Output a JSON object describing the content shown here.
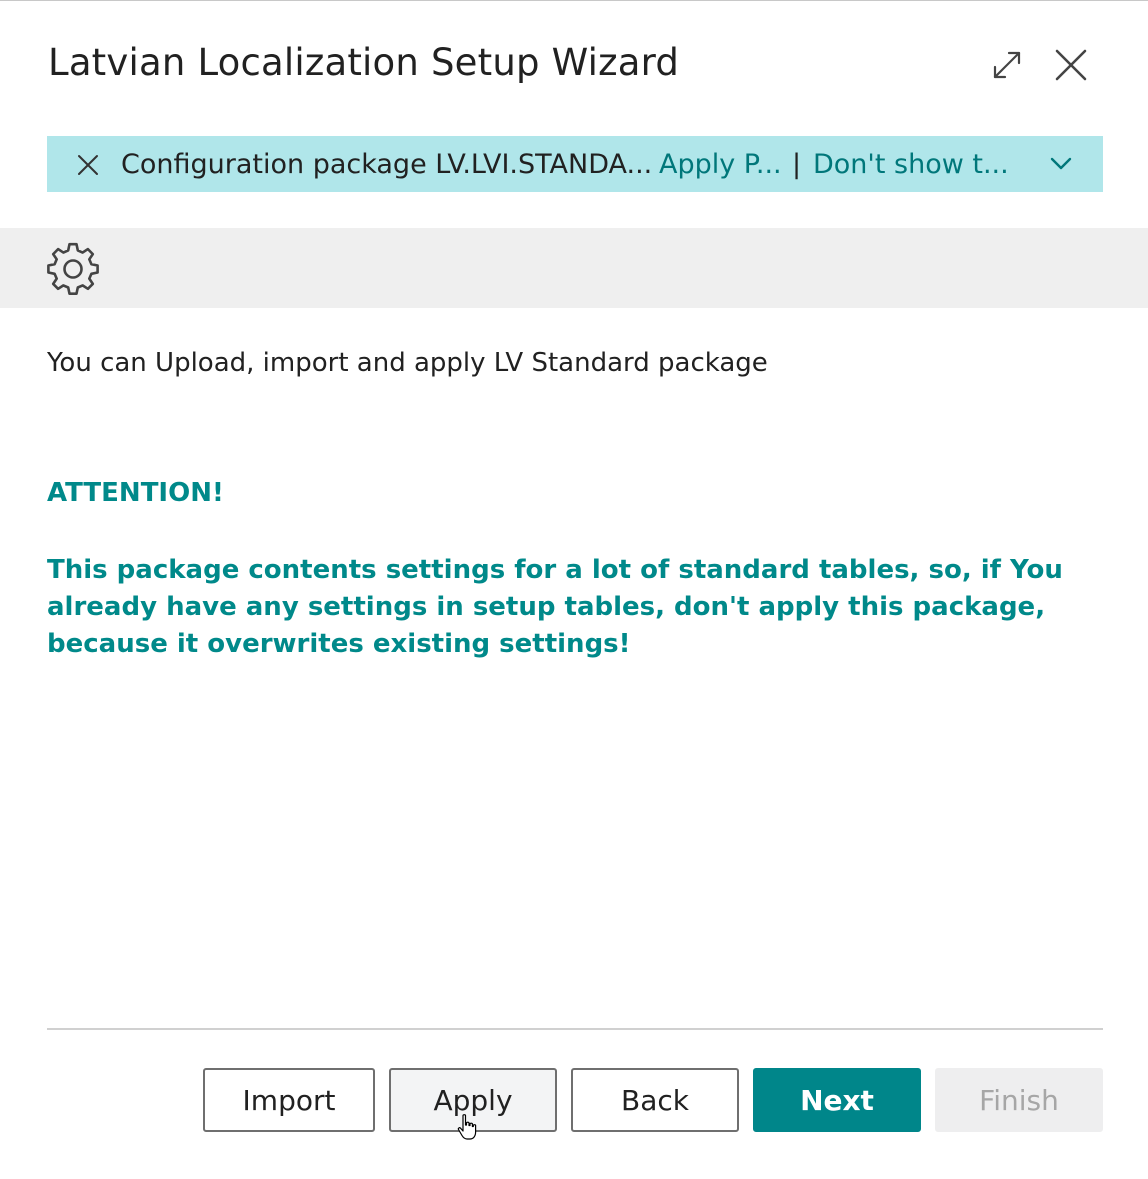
{
  "dialog": {
    "title": "Latvian Localization Setup Wizard",
    "expand_icon": "expand-arrows-icon",
    "close_icon": "close-icon"
  },
  "notification": {
    "dismiss_icon": "close-icon",
    "message": "Configuration package LV.LVI.STANDA...",
    "action_apply": "Apply P...",
    "separator": "|",
    "action_dont_show": "Don't show t...",
    "expand_icon": "chevron-down-icon",
    "background_color": "#b0e6ea",
    "link_color": "#00777a"
  },
  "banner": {
    "icon": "gear-icon"
  },
  "content": {
    "intro": "You can Upload, import and apply LV Standard package",
    "attention": "ATTENTION!",
    "warning": "This package contents settings for a lot of standard tables, so, if You already have any settings in setup tables, don't apply this package, because it overwrites existing settings!",
    "accent_color": "#00898a"
  },
  "footer": {
    "import_label": "Import",
    "apply_label": "Apply",
    "back_label": "Back",
    "next_label": "Next",
    "finish_label": "Finish",
    "primary_color": "#00868a"
  }
}
